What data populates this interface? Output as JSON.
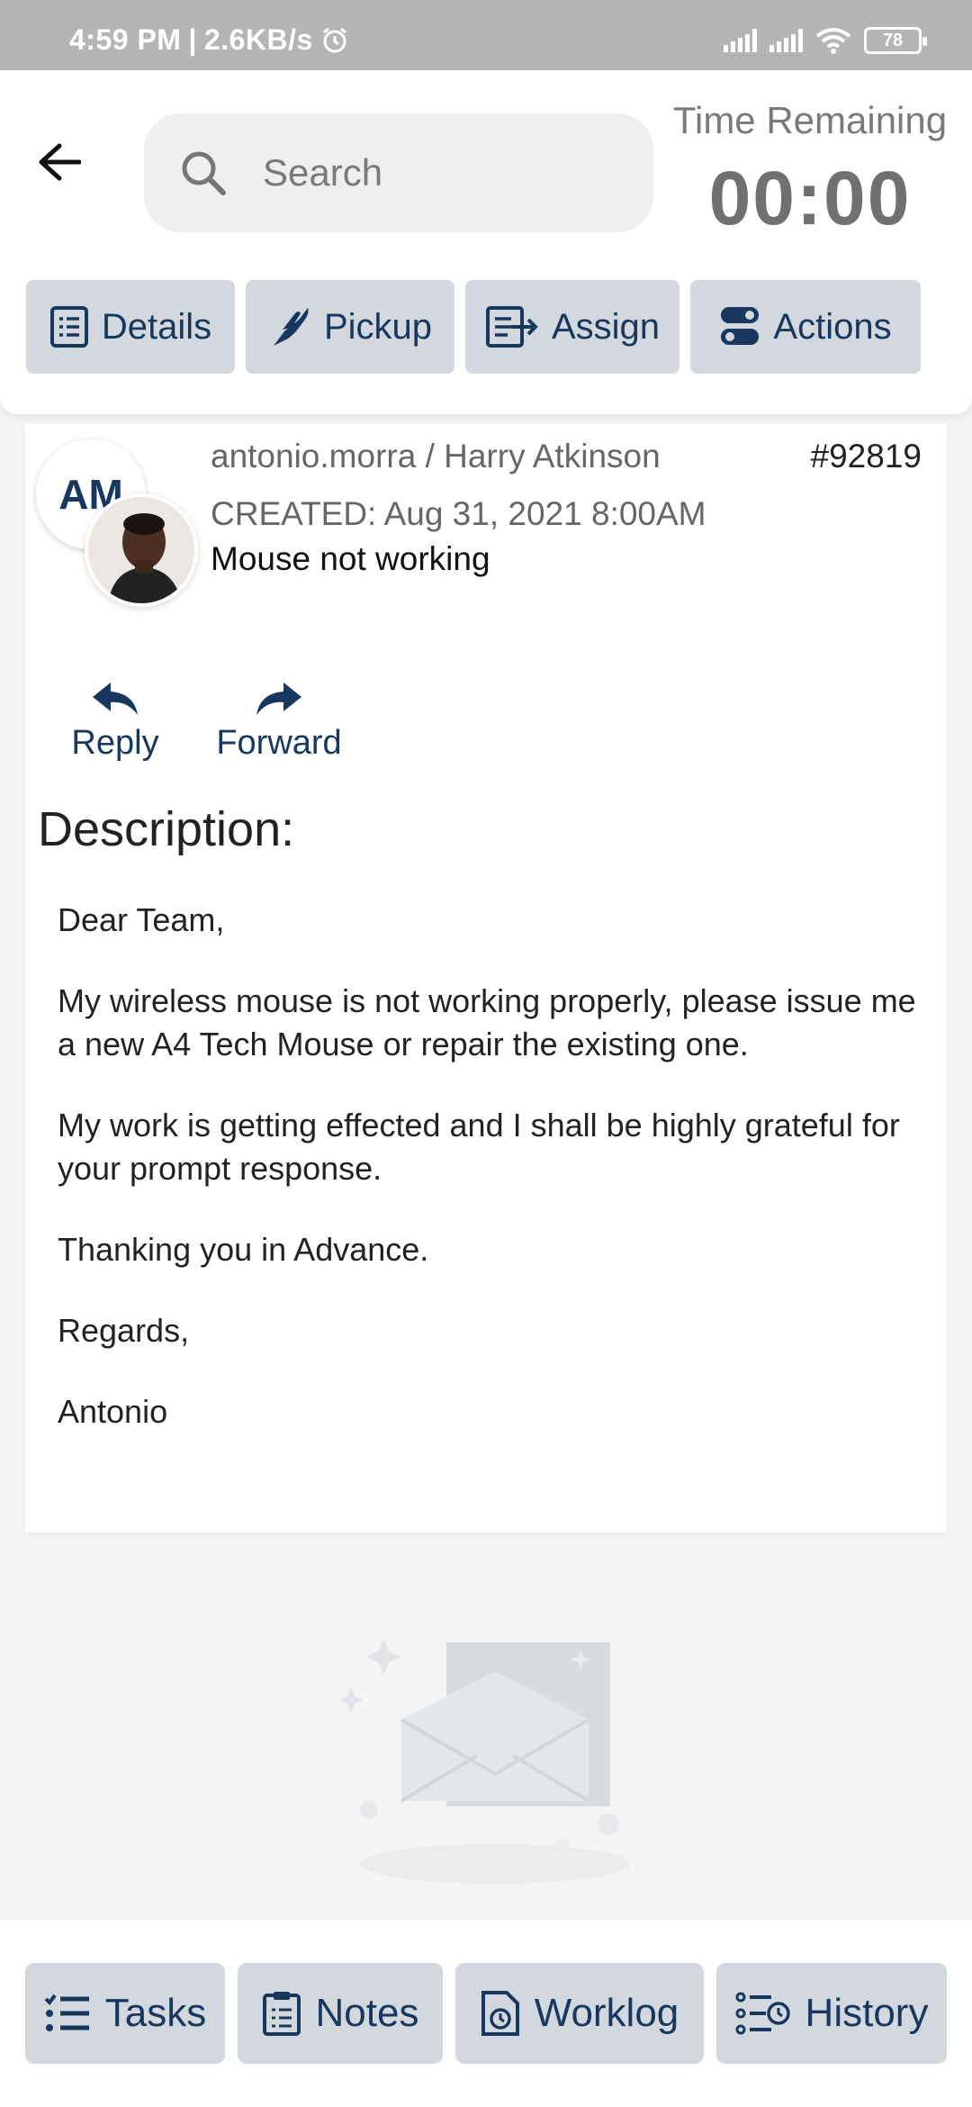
{
  "status_bar": {
    "time": "4:59 PM",
    "speed": "2.6KB/s",
    "battery": "78"
  },
  "header": {
    "search_placeholder": "Search",
    "time_remaining_label": "Time Remaining",
    "time_remaining_value": "00:00",
    "tabs": [
      {
        "label": "Details",
        "icon": "details-icon"
      },
      {
        "label": "Pickup",
        "icon": "pickup-hand-icon"
      },
      {
        "label": "Assign",
        "icon": "assign-icon"
      },
      {
        "label": "Actions",
        "icon": "toggle-actions-icon"
      }
    ]
  },
  "ticket": {
    "initials": "AM",
    "users": "antonio.morra / Harry Atkinson",
    "id": "#92819",
    "created": "CREATED: Aug 31, 2021 8:00AM",
    "subject": "Mouse not working",
    "reply_label": "Reply",
    "forward_label": "Forward",
    "description_title": "Description:",
    "description_paragraphs": [
      "Dear Team,",
      "My wireless mouse is not working properly, please issue me a new A4 Tech Mouse or repair the existing one.",
      "My work is getting effected and I shall be highly grateful for your prompt response.",
      "Thanking you in Advance.",
      "Regards,",
      "Antonio"
    ]
  },
  "bottom_nav": [
    {
      "label": "Tasks",
      "icon": "tasks-list-icon"
    },
    {
      "label": "Notes",
      "icon": "notes-clipboard-icon"
    },
    {
      "label": "Worklog",
      "icon": "worklog-clock-icon"
    },
    {
      "label": "History",
      "icon": "history-icon"
    }
  ],
  "colors": {
    "accent": "#17375e",
    "button_bg": "#d2d8de",
    "status_bar": "#b5b5b5"
  }
}
